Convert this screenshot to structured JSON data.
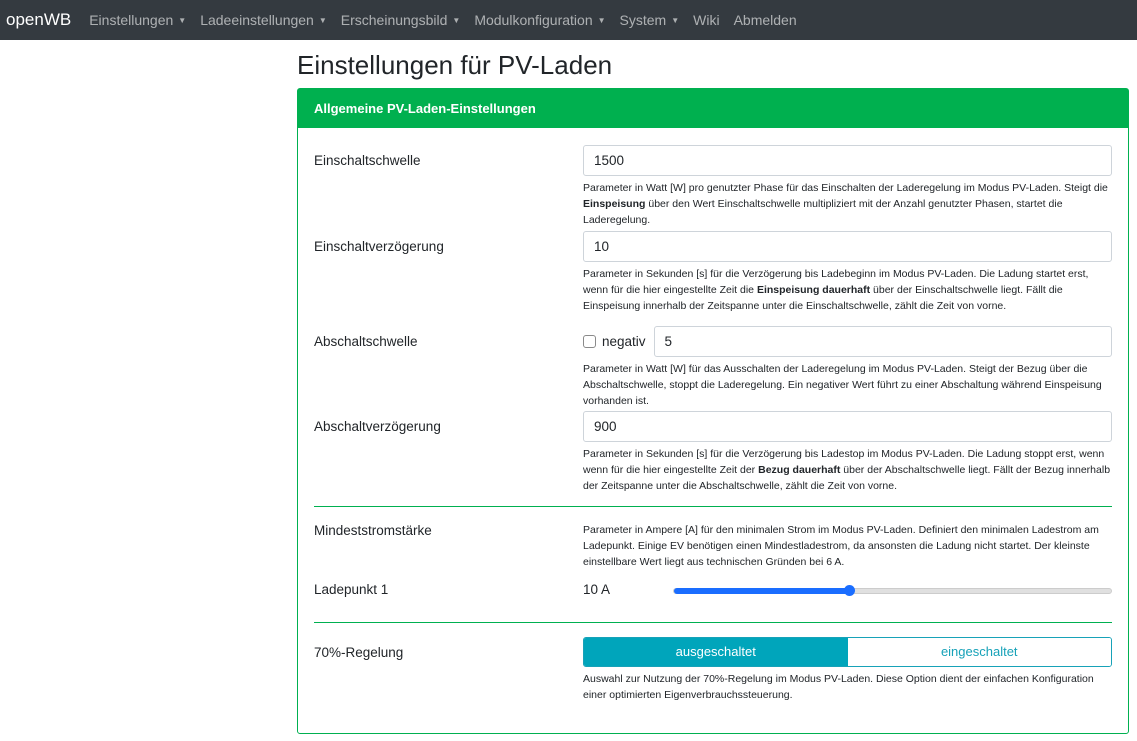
{
  "nav": {
    "brand": "openWB",
    "items": [
      {
        "label": "Einstellungen",
        "dropdown": true
      },
      {
        "label": "Ladeeinstellungen",
        "dropdown": true
      },
      {
        "label": "Erscheinungsbild",
        "dropdown": true
      },
      {
        "label": "Modulkonfiguration",
        "dropdown": true
      },
      {
        "label": "System",
        "dropdown": true
      },
      {
        "label": "Wiki",
        "dropdown": false
      },
      {
        "label": "Abmelden",
        "dropdown": false
      }
    ]
  },
  "page_title": "Einstellungen für PV-Laden",
  "card_title": "Allgemeine PV-Laden-Einstellungen",
  "einschaltschwelle": {
    "label": "Einschaltschwelle",
    "value": "1500",
    "help": [
      "Parameter in Watt [W] pro genutzter Phase für das Einschalten der Laderegelung im Modus PV-Laden. Steigt die ",
      "Einspeisung",
      " über den Wert Einschaltschwelle multipliziert mit der Anzahl genutzter Phasen, startet die Laderegelung."
    ]
  },
  "einschaltverzoegerung": {
    "label": "Einschaltverzögerung",
    "value": "10",
    "help": [
      "Parameter in Sekunden [s] für die Verzögerung bis Ladebeginn im Modus PV-Laden. Die Ladung startet erst, wenn für die hier eingestellte Zeit die ",
      "Einspeisung dauerhaft",
      " über der Einschaltschwelle liegt. Fällt die Einspeisung innerhalb der Zeitspanne unter die Einschaltschwelle, zählt die Zeit von vorne."
    ]
  },
  "abschaltschwelle": {
    "label": "Abschaltschwelle",
    "checkbox_label": "negativ",
    "checked": false,
    "value": "5",
    "help": [
      "Parameter in Watt [W] für das Ausschalten der Laderegelung im Modus PV-Laden. Steigt der Bezug über die Abschaltschwelle, stoppt die Laderegelung. Ein negativer Wert führt zu einer Abschaltung während Einspeisung vorhanden ist.",
      "",
      ""
    ]
  },
  "abschaltverzoegerung": {
    "label": "Abschaltverzögerung",
    "value": "900",
    "help": [
      "Parameter in Sekunden [s] für die Verzögerung bis Ladestop im Modus PV-Laden. Die Ladung stoppt erst, wenn wenn für die hier eingestellte Zeit der ",
      "Bezug dauerhaft",
      " über der Abschaltschwelle liegt. Fällt der Bezug innerhalb der Zeitspanne unter die Abschaltschwelle, zählt die Zeit von vorne."
    ]
  },
  "mindeststrom": {
    "label": "Mindeststromstärke",
    "help": "Parameter in Ampere [A] für den minimalen Strom im Modus PV-Laden. Definiert den minimalen Ladestrom am Ladepunkt. Einige EV benötigen einen Mindestladestrom, da ansonsten die Ladung nicht startet. Der kleinste einstellbare Wert liegt aus technischen Gründen bei 6 A.",
    "ladepunkt_label": "Ladepunkt 1",
    "value_text": "10 A",
    "value": 10,
    "min": 6,
    "max": 16
  },
  "regelung70": {
    "label": "70%-Regelung",
    "options": [
      "ausgeschaltet",
      "eingeschaltet"
    ],
    "selected": "ausgeschaltet",
    "help": "Auswahl zur Nutzung der 70%-Regelung im Modus PV-Laden. Diese Option dient der einfachen Konfiguration einer optimierten Eigenverbrauchssteuerung."
  },
  "colors": {
    "navbar": "#343a40",
    "success": "#00b04f",
    "info": "#17a2b8",
    "slider": "#1a6dff"
  }
}
